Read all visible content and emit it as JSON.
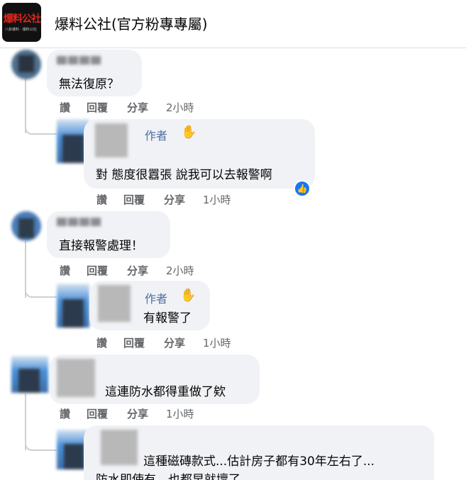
{
  "header": {
    "page_name": "爆料公社(官方粉專專屬)",
    "logo_text": "爆料公社",
    "logo_subtext": "八卦爆料 · 爆料公社"
  },
  "labels": {
    "like": "讚",
    "reply": "回覆",
    "share": "分享",
    "author": "作者"
  },
  "comments": [
    {
      "text": "無法復原？",
      "time": "2小時"
    },
    {
      "text": "對 態度很囂張 說我可以去報警啊",
      "time": "1小時",
      "is_author": true,
      "liked": true
    },
    {
      "text": "直接報警處理！",
      "time": "2小時"
    },
    {
      "text": "有報警了",
      "time": "1小時",
      "is_author": true
    },
    {
      "text": "這連防水都得重做了欸",
      "time": "1小時"
    },
    {
      "text_line1": "這種磁磚款式...估計房子都有30年左右了...",
      "text_line2": "防水即使有，也都早就壞了"
    }
  ],
  "colors": {
    "bubble": "#f0f2f5",
    "action_text": "#65676b",
    "author_badge": "#4a6fa5",
    "like_blue": "#1877f2",
    "logo_red": "#e0251f"
  }
}
